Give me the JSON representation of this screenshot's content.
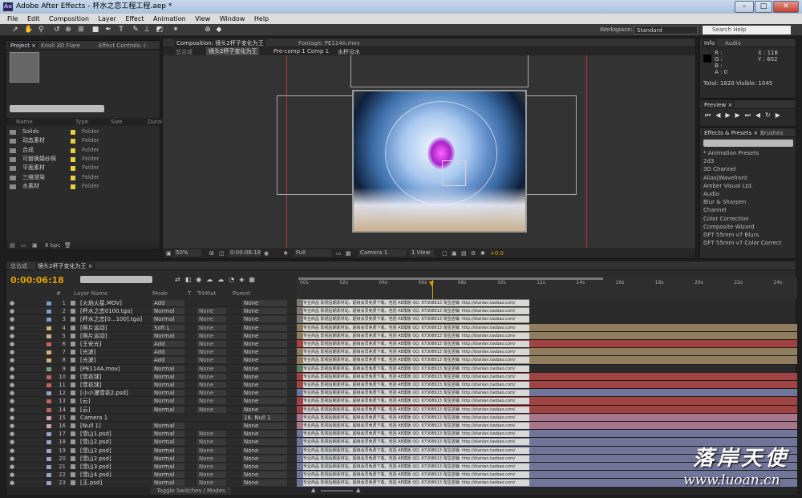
{
  "window": {
    "title": "Adobe After Effects - 杯水之恋工程工程.aep *",
    "app_icon": "Ae",
    "min": "–",
    "max": "□",
    "close": "✕"
  },
  "menu": [
    "File",
    "Edit",
    "Composition",
    "Layer",
    "Effect",
    "Animation",
    "View",
    "Window",
    "Help"
  ],
  "toolbar": {
    "workspace_label": "Workspace:",
    "workspace_value": "Standard",
    "search_placeholder": "Search Help"
  },
  "project": {
    "tabs": [
      "Project ×",
      "Knoll 3D Flare",
      "Effect Controls: (-"
    ],
    "columns": [
      "Name",
      "Type",
      "Size",
      "Durat"
    ],
    "items": [
      {
        "name": "Solids",
        "type": "Folder"
      },
      {
        "name": "动态素材",
        "type": "Folder"
      },
      {
        "name": "合成",
        "type": "Folder"
      },
      {
        "name": "可替换婚纱照",
        "type": "Folder"
      },
      {
        "name": "平面素材",
        "type": "Folder"
      },
      {
        "name": "三维渲染",
        "type": "Folder"
      },
      {
        "name": "水素材",
        "type": "Folder"
      }
    ],
    "bpc": "8 bpc"
  },
  "composition": {
    "tabs": [
      "Composition: 镜头2杯子变化为王",
      "Footage: PE114A.mov"
    ],
    "breadcrumbs": [
      "总合成",
      "镜头2杯子变化为王",
      "Pre-comp 1 Comp 1",
      "水杯没水"
    ],
    "zoom": "50%",
    "time": "0:00:06:18",
    "resolution": "Full",
    "camera": "Camera 1",
    "views": "1 View",
    "exposure": "+0.0"
  },
  "info": {
    "tabs": [
      "Info",
      "Audio"
    ],
    "r": "R :",
    "g": "G :",
    "b": "B :",
    "a": "A : 0",
    "x": "X : 118",
    "y": "Y : 602",
    "total": "Total: 1820  Visible: 1045"
  },
  "preview": {
    "tab": "Preview ×"
  },
  "effects": {
    "tabs": [
      "Effects & Presets ×",
      "Brushes"
    ],
    "items": [
      "* Animation Presets",
      "2d3",
      "3D Channel",
      "Alias|Wavefront",
      "Amber Visual Ltd.",
      "Audio",
      "Blur & Sharpen",
      "Channel",
      "Color Correction",
      "Composite Wizard",
      "DFT 55mm v7 Blurs",
      "DFT 55mm v7 Color Correct"
    ]
  },
  "timeline": {
    "tabs": [
      "总合成",
      "镜头2杯子变化为王 ×"
    ],
    "time": "0:00:06:18",
    "columns": [
      "#",
      "Layer Name",
      "Mode",
      "T",
      "TrkMat",
      "Parent"
    ],
    "ruler": [
      "00s",
      "02s",
      "04s",
      "06s",
      "08s",
      "10s",
      "12s",
      "14s",
      "16s",
      "18s",
      "20s",
      "22s",
      "24s"
    ],
    "track_text": "专业商品 影视后期素材站，超级会员免费下载，包括 AE模板 QQ: 67308913 淘宝店铺: http://dianlan.taobao.com/",
    "layers": [
      {
        "n": "1",
        "name": "[火焰火星.MOV]",
        "mode": "Add",
        "trk": "",
        "parent": "None",
        "lc": "#7a9ec8",
        "bc": "#7d7a73"
      },
      {
        "n": "2",
        "name": "[杯水之恋0100.tga]",
        "mode": "Normal",
        "trk": "None",
        "parent": "None",
        "lc": "#7a9ec8",
        "bc": "#7d7a73"
      },
      {
        "n": "3",
        "name": "[杯水之恋[0...100].tga]",
        "mode": "Normal",
        "trk": "None",
        "parent": "None",
        "lc": "#7a9ec8",
        "bc": "#7d7a73"
      },
      {
        "n": "4",
        "name": "[照片运动]",
        "mode": "Soft L",
        "trk": "None",
        "parent": "None",
        "lc": "#d0b27a",
        "bc": "#8f7d5e"
      },
      {
        "n": "5",
        "name": "[照片运动]",
        "mode": "Normal",
        "trk": "None",
        "parent": "None",
        "lc": "#d0b27a",
        "bc": "#8f7d5e"
      },
      {
        "n": "6",
        "name": "[王安光]",
        "mode": "Add",
        "trk": "None",
        "parent": "None",
        "lc": "#c46161",
        "bc": "#a14343"
      },
      {
        "n": "7",
        "name": "[光波]",
        "mode": "Add",
        "trk": "None",
        "parent": "None",
        "lc": "#d0b27a",
        "bc": "#8f7d5e"
      },
      {
        "n": "8",
        "name": "[光波]",
        "mode": "Add",
        "trk": "None",
        "parent": "None",
        "lc": "#d0b27a",
        "bc": "#8f7d5e"
      },
      {
        "n": "9",
        "name": "[PE114A.mov]",
        "mode": "Normal",
        "trk": "None",
        "parent": "None",
        "lc": "#7aa07a",
        "bc": "#5f7d5f"
      },
      {
        "n": "10",
        "name": "[雪花球]",
        "mode": "Normal",
        "trk": "None",
        "parent": "None",
        "lc": "#c46161",
        "bc": "#a14343"
      },
      {
        "n": "11",
        "name": "[雪花球]",
        "mode": "Normal",
        "trk": "None",
        "parent": "None",
        "lc": "#c46161",
        "bc": "#a14343"
      },
      {
        "n": "12",
        "name": "[小小漫雪花2.psd]",
        "mode": "Normal",
        "trk": "None",
        "parent": "None",
        "lc": "#9aa0c8",
        "bc": "#72759a"
      },
      {
        "n": "13",
        "name": "[云]",
        "mode": "Normal",
        "trk": "None",
        "parent": "None",
        "lc": "#c46161",
        "bc": "#a14343"
      },
      {
        "n": "14",
        "name": "[云]",
        "mode": "Normal",
        "trk": "None",
        "parent": "None",
        "lc": "#c46161",
        "bc": "#a14343"
      },
      {
        "n": "15",
        "name": "Camera 1",
        "mode": "",
        "trk": "",
        "parent": "16. Null 1",
        "lc": "#d4a0b4",
        "bc": "#a7768a"
      },
      {
        "n": "16",
        "name": "[Null 1]",
        "mode": "Normal",
        "trk": "",
        "parent": "None",
        "lc": "#d4a0b4",
        "bc": "#a7768a"
      },
      {
        "n": "17",
        "name": "[雪山1.psd]",
        "mode": "Normal",
        "trk": "None",
        "parent": "None",
        "lc": "#9aa0c8",
        "bc": "#72759a"
      },
      {
        "n": "18",
        "name": "[雪山2.psd]",
        "mode": "Normal",
        "trk": "None",
        "parent": "None",
        "lc": "#9aa0c8",
        "bc": "#72759a"
      },
      {
        "n": "19",
        "name": "[雪山2.psd]",
        "mode": "Normal",
        "trk": "None",
        "parent": "None",
        "lc": "#9aa0c8",
        "bc": "#72759a"
      },
      {
        "n": "20",
        "name": "[雪山2.psd]",
        "mode": "Normal",
        "trk": "None",
        "parent": "None",
        "lc": "#9aa0c8",
        "bc": "#72759a"
      },
      {
        "n": "21",
        "name": "[雪山3.psd]",
        "mode": "Normal",
        "trk": "None",
        "parent": "None",
        "lc": "#9aa0c8",
        "bc": "#72759a"
      },
      {
        "n": "22",
        "name": "[雪山4.psd]",
        "mode": "Normal",
        "trk": "None",
        "parent": "None",
        "lc": "#9aa0c8",
        "bc": "#72759a"
      },
      {
        "n": "23",
        "name": "[王.psd]",
        "mode": "Normal",
        "trk": "None",
        "parent": "None",
        "lc": "#9aa0c8",
        "bc": "#72759a"
      }
    ],
    "toggle_label": "Toggle Switches / Modes"
  },
  "watermark": {
    "title": "落岸天使",
    "url": "www.luoan.cn"
  }
}
